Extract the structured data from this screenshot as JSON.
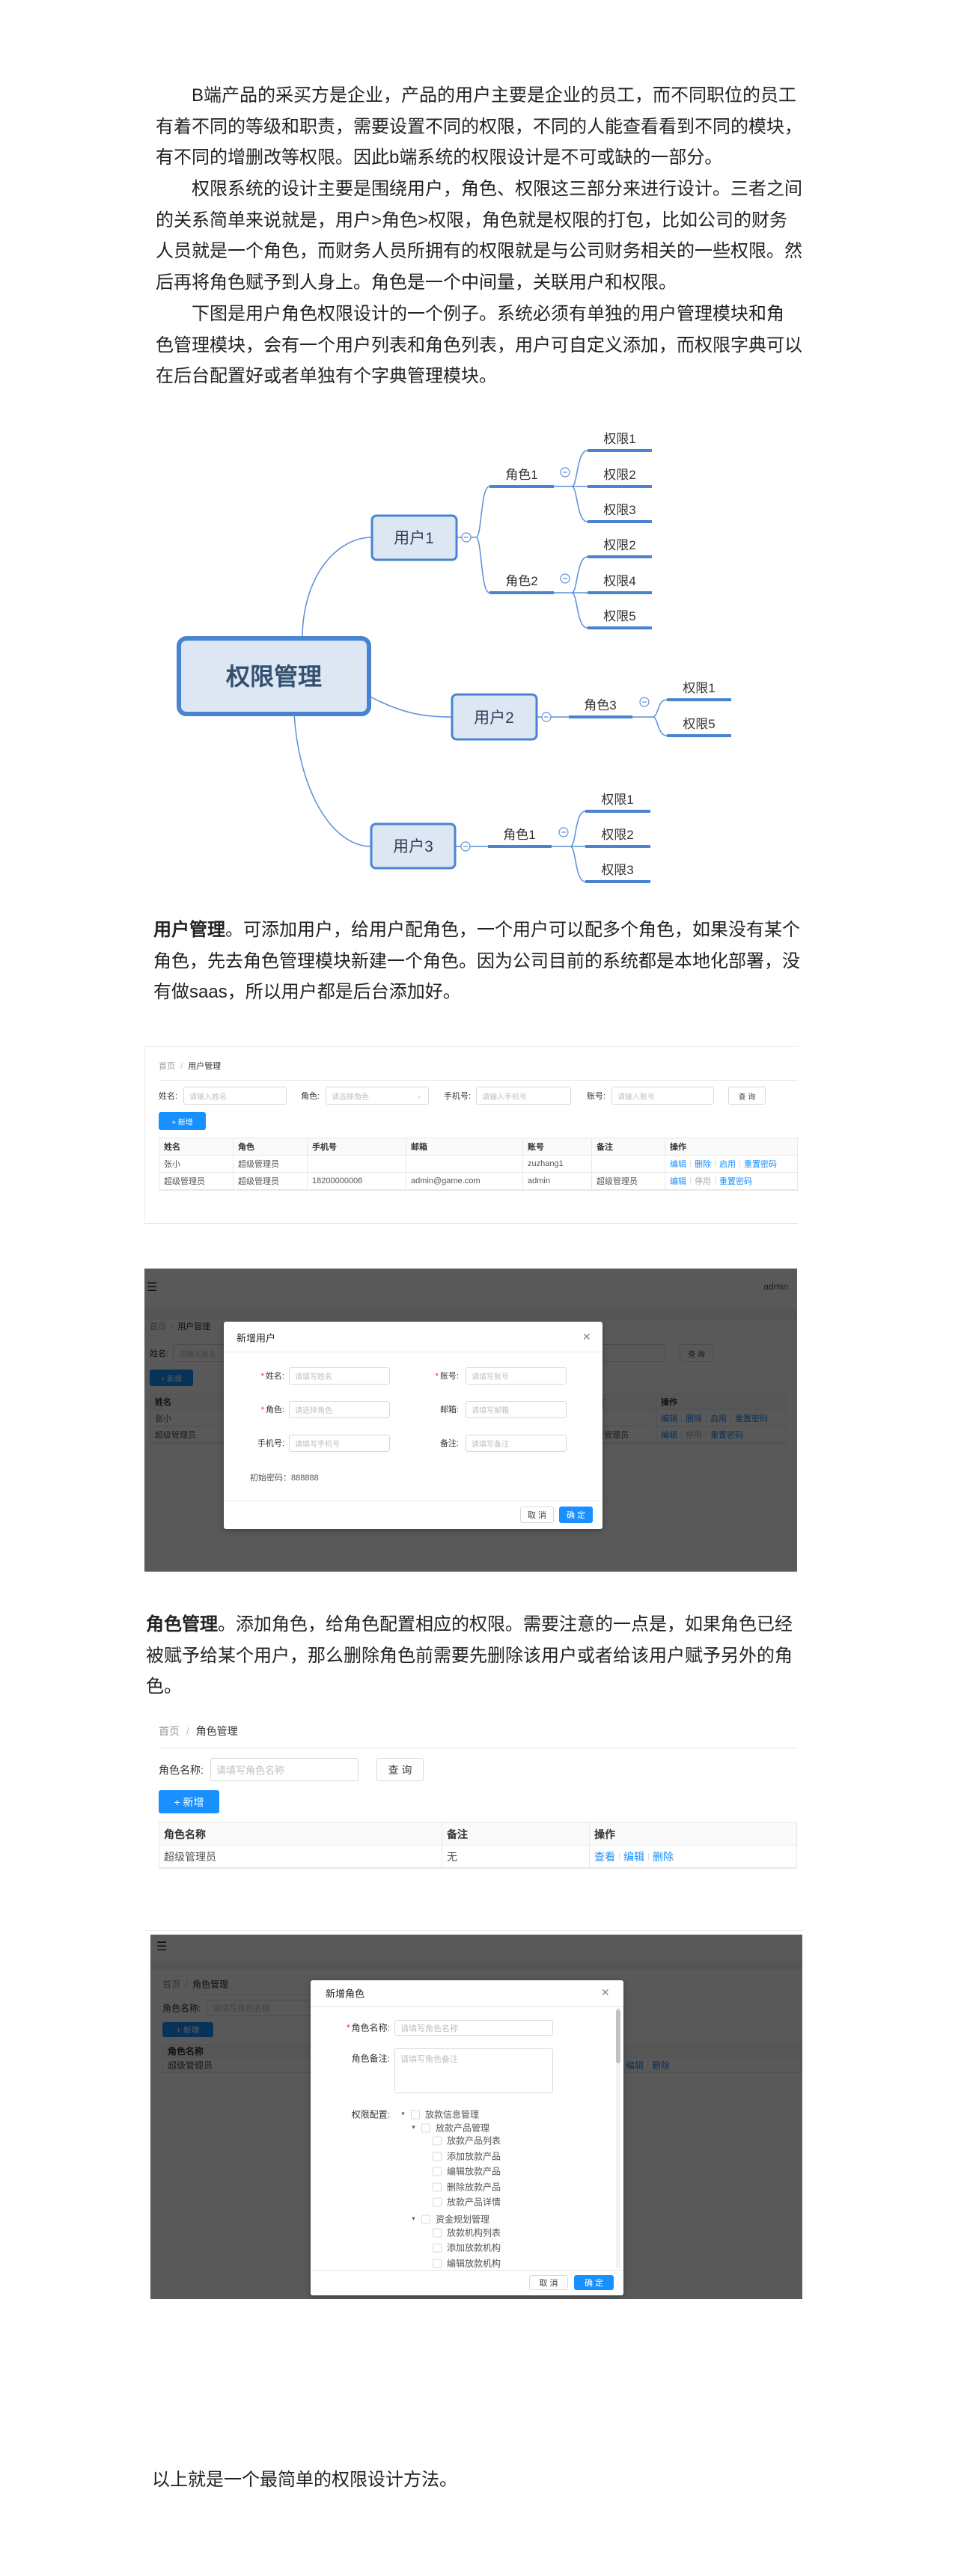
{
  "article": {
    "p1": [
      "B端产品的采买方是企业，产品的用户主要是企业的员工，而不同职位的员工",
      "有着不同的等级和职责，需要设置不同的权限，不同的人能查看看到不同的模块，",
      "有不同的增删改等权限。因此b端系统的权限设计是不可或缺的一部分。"
    ],
    "p2": [
      "权限系统的设计主要是围绕用户，角色、权限这三部分来进行设计。三者之间",
      "的关系简单来说就是，用户>角色>权限，角色就是权限的打包，比如公司的财务",
      "人员就是一个角色，而财务人员所拥有的权限就是与公司财务相关的一些权限。然",
      "后再将角色赋予到人身上。角色是一个中间量，关联用户和权限。"
    ],
    "p3": [
      "下图是用户角色权限设计的一个例子。系统必须有单独的用户管理模块和角",
      "色管理模块，会有一个用户列表和角色列表，用户可自定义添加，而权限字典可以",
      "在后台配置好或者单独有个字典管理模块。"
    ],
    "user_mgmt": {
      "bold": "用户管理",
      "lines": [
        "。可添加用户，给用户配角色，一个用户可以配多个角色，如果没有某个",
        "角色，先去角色管理模块新建一个角色。因为公司目前的系统都是本地化部署，没",
        "有做saas，所以用户都是后台添加好。"
      ]
    },
    "role_mgmt": {
      "bold": "角色管理",
      "lines": [
        "。添加角色，给角色配置相应的权限。需要注意的一点是，如果角色已经",
        "被赋予给某个用户，那么删除角色前需要先删除该用户或者给该用户赋予另外的角",
        "色。"
      ]
    },
    "conclusion": "以上就是一个最简单的权限设计方法。"
  },
  "mindmap": {
    "root": "权限管理",
    "colors": {
      "line": "#5b8fd6",
      "border": "#4a84d0",
      "fill": "#dde7f4"
    },
    "users": [
      {
        "label": "用户1",
        "roles": [
          {
            "label": "角色1",
            "perms": [
              "权限1",
              "权限2",
              "权限3"
            ]
          },
          {
            "label": "角色2",
            "perms": [
              "权限2",
              "权限4",
              "权限5"
            ]
          }
        ]
      },
      {
        "label": "用户2",
        "roles": [
          {
            "label": "角色3",
            "perms": [
              "权限1",
              "权限5"
            ]
          }
        ]
      },
      {
        "label": "用户3",
        "roles": [
          {
            "label": "角色1",
            "perms": [
              "权限1",
              "权限2",
              "权限3"
            ]
          }
        ]
      }
    ]
  },
  "user_list": {
    "breadcrumb": {
      "home": "首页",
      "sep": "/",
      "current": "用户管理"
    },
    "filters": {
      "name_label": "姓名:",
      "name_placeholder": "请输入姓名",
      "role_label": "角色:",
      "role_placeholder": "请选择角色",
      "phone_label": "手机号:",
      "phone_placeholder": "请输入手机号",
      "account_label": "账号:",
      "account_placeholder": "请输入账号",
      "query": "查 询"
    },
    "add_button": "+ 新增",
    "table": {
      "headers": [
        "姓名",
        "角色",
        "手机号",
        "邮箱",
        "账号",
        "备注",
        "操作"
      ],
      "rows": [
        {
          "cells": [
            "张小",
            "超级管理员",
            "",
            "",
            "zuzhang1",
            ""
          ],
          "actions": [
            {
              "label": "编辑",
              "muted": false
            },
            {
              "label": "删除",
              "muted": false
            },
            {
              "label": "启用",
              "muted": false
            },
            {
              "label": "重置密码",
              "muted": false
            }
          ]
        },
        {
          "cells": [
            "超级管理员",
            "超级管理员",
            "18200000006",
            "admin@game.com",
            "admin",
            "超级管理员"
          ],
          "actions": [
            {
              "label": "编辑",
              "muted": false
            },
            {
              "label": "停用",
              "muted": true
            },
            {
              "label": "重置密码",
              "muted": false
            }
          ]
        }
      ]
    }
  },
  "add_user_dialog": {
    "app_user": "admin",
    "title": "新增用户",
    "fields": [
      {
        "label": "姓名:",
        "placeholder": "请填写姓名",
        "required": true
      },
      {
        "label": "账号:",
        "placeholder": "请填写账号",
        "required": true
      },
      {
        "label": "角色:",
        "placeholder": "请选择角色",
        "required": true
      },
      {
        "label": "邮箱:",
        "placeholder": "请填写邮箱",
        "required": false
      },
      {
        "label": "手机号:",
        "placeholder": "请填写手机号",
        "required": false
      },
      {
        "label": "备注:",
        "placeholder": "请填写备注",
        "required": false
      }
    ],
    "required_mark": "*",
    "initial_password": "初始密码：888888",
    "cancel": "取 消",
    "ok": "确 定"
  },
  "role_list": {
    "breadcrumb": {
      "home": "首页",
      "sep": "/",
      "current": "角色管理"
    },
    "filter_label": "角色名称:",
    "filter_placeholder": "请填写角色名称",
    "query": "查 询",
    "add_button": "+ 新增",
    "table": {
      "headers": [
        "角色名称",
        "备注",
        "操作"
      ],
      "rows": [
        {
          "cells": [
            "超级管理员",
            "无"
          ],
          "actions": [
            {
              "label": "查看",
              "muted": false
            },
            {
              "label": "编辑",
              "muted": false
            },
            {
              "label": "删除",
              "muted": false
            }
          ]
        }
      ]
    }
  },
  "add_role_dialog": {
    "title": "新增角色",
    "name_label": "角色名称:",
    "name_placeholder": "请填写角色名称",
    "remark_label": "角色备注:",
    "remark_placeholder": "请填写角色备注",
    "perm_label": "权限配置:",
    "tree": [
      {
        "label": "放款信息管理",
        "level": 0,
        "expandable": true
      },
      {
        "label": "放款产品管理",
        "level": 1,
        "expandable": true
      },
      {
        "label": "放款产品列表",
        "level": 2,
        "expandable": false
      },
      {
        "label": "添加放款产品",
        "level": 2,
        "expandable": false
      },
      {
        "label": "编辑放款产品",
        "level": 2,
        "expandable": false
      },
      {
        "label": "删除放款产品",
        "level": 2,
        "expandable": false
      },
      {
        "label": "放款产品详情",
        "level": 2,
        "expandable": false
      },
      {
        "label": "资金规划管理",
        "level": 1,
        "expandable": true
      },
      {
        "label": "放款机构列表",
        "level": 2,
        "expandable": false
      },
      {
        "label": "添加放款机构",
        "level": 2,
        "expandable": false
      },
      {
        "label": "编辑放款机构",
        "level": 2,
        "expandable": false
      }
    ],
    "cancel": "取 消",
    "ok": "确 定"
  }
}
